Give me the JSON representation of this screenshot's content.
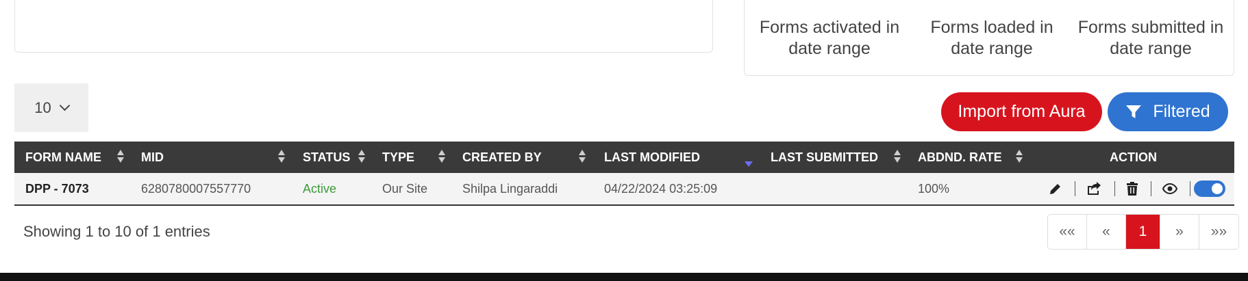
{
  "stats": [
    {
      "label": "Forms activated in date range"
    },
    {
      "label": "Forms loaded in date range"
    },
    {
      "label": "Forms submitted in date range"
    }
  ],
  "page_size": {
    "value": "10"
  },
  "buttons": {
    "import_label": "Import from Aura",
    "filter_label": "Filtered"
  },
  "table": {
    "columns": [
      "FORM NAME",
      "MID",
      "STATUS",
      "TYPE",
      "CREATED BY",
      "LAST MODIFIED",
      "LAST SUBMITTED",
      "ABDND. RATE",
      "ACTION"
    ],
    "rows": [
      {
        "form_name": "DPP - 7073",
        "mid": "6280780007557770",
        "status": "Active",
        "type": "Our Site",
        "created_by": "Shilpa Lingaraddi",
        "last_modified": "04/22/2024 03:25:09",
        "last_submitted": "",
        "abandon_rate": "100%",
        "enabled": true
      }
    ]
  },
  "info": "Showing 1 to 10 of 1 entries",
  "pagination": {
    "first": "««",
    "prev": "«",
    "current": "1",
    "next": "»",
    "last": "»»"
  },
  "icons": [
    "pencil-icon",
    "share-icon",
    "trash-icon",
    "eye-icon",
    "toggle-switch",
    "filter-icon",
    "chevron-down-icon"
  ],
  "colors": {
    "primary_red": "#d7141e",
    "primary_blue": "#2f74d0",
    "header_dark": "#3a3a3a",
    "status_active": "#3b9a3b"
  }
}
